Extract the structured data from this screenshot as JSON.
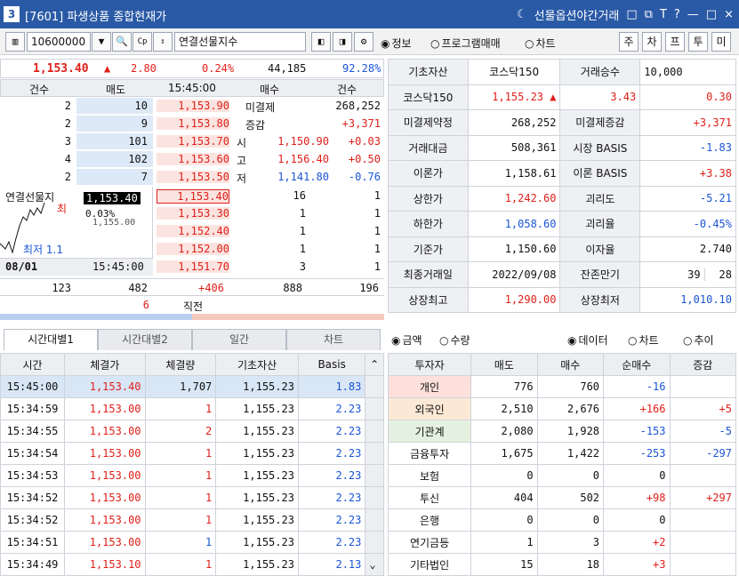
{
  "title": {
    "num": "3",
    "text": "[7601] 파생상품 종합현재가",
    "night": "선물옵션야간거래",
    "icons": [
      "□",
      "⧉",
      "T",
      "?",
      "—",
      "□",
      "×"
    ]
  },
  "toolbar": {
    "code": "10600000",
    "name": "연결선물지수",
    "radios": [
      "정보",
      "프로그램매매",
      "차트"
    ],
    "mini": [
      "주",
      "차",
      "프",
      "투",
      "미"
    ]
  },
  "quote": {
    "price": "1,153.40",
    "arrow": "▲",
    "change": "2.80",
    "rate": "0.24%",
    "volume": "44,185",
    "ratio": "92.28%"
  },
  "ob_head": [
    "건수",
    "매도",
    "15:45:00",
    "매수",
    "건수"
  ],
  "asks": [
    [
      "2",
      "10",
      "1,153.90"
    ],
    [
      "2",
      "9",
      "1,153.80"
    ],
    [
      "3",
      "101",
      "1,153.70"
    ],
    [
      "4",
      "102",
      "1,153.60"
    ],
    [
      "2",
      "7",
      "1,153.50"
    ]
  ],
  "ask_info": [
    [
      "미결제",
      "268,252",
      ""
    ],
    [
      "증감",
      "+3,371",
      ""
    ],
    [
      "시",
      "1,150.90",
      "+0.03"
    ],
    [
      "고",
      "1,156.40",
      "+0.50"
    ],
    [
      "저",
      "1,141.80",
      "-0.76"
    ]
  ],
  "bids": [
    [
      "1,153.40",
      "16",
      "1"
    ],
    [
      "1,153.30",
      "1",
      "1"
    ],
    [
      "1,152.40",
      "1",
      "1"
    ],
    [
      "1,152.00",
      "1",
      "1"
    ],
    [
      "1,151.70",
      "3",
      "1"
    ]
  ],
  "mini_chart": {
    "name": "연결선물지",
    "price": "1,153.40",
    "rate": "0.03%",
    "low_val": "1,155.00",
    "hi": "최",
    "lo": "최저 1.1",
    "date": "08/01",
    "time": "15:45:00"
  },
  "ob_total": [
    "123",
    "482",
    "+406",
    "888",
    "196"
  ],
  "ob_last": {
    "val": "6",
    "label": "직전"
  },
  "info": [
    [
      "기초자산",
      "코스닥150",
      "거래승수",
      "10,000"
    ],
    [
      "코스닥150",
      "1,155.23 ▲",
      "3.43",
      "0.30"
    ],
    [
      "미결제약정",
      "268,252",
      "미결제증감",
      "+3,371"
    ],
    [
      "거래대금",
      "508,361",
      "시장 BASIS",
      "-1.83"
    ],
    [
      "이론가",
      "1,158.61",
      "이론 BASIS",
      "+3.38"
    ],
    [
      "상한가",
      "1,242.60",
      "괴리도",
      "-5.21"
    ],
    [
      "하한가",
      "1,058.60",
      "괴리율",
      "-0.45%"
    ],
    [
      "기준가",
      "1,150.60",
      "이자율",
      "2.740"
    ],
    [
      "최종거래일",
      "2022/09/08",
      "잔존만기",
      "39",
      "28"
    ],
    [
      "상장최고",
      "1,290.00",
      "상장최저",
      "1,010.10"
    ]
  ],
  "tabs": [
    "시간대별1",
    "시간대별2",
    "일간",
    "차트"
  ],
  "trade_head": [
    "시간",
    "체결가",
    "체결량",
    "기초자산",
    "Basis"
  ],
  "trades": [
    [
      "15:45:00",
      "1,153.40",
      "1,707",
      "1,155.23",
      "1.83"
    ],
    [
      "15:34:59",
      "1,153.00",
      "1",
      "1,155.23",
      "2.23"
    ],
    [
      "15:34:55",
      "1,153.00",
      "2",
      "1,155.23",
      "2.23"
    ],
    [
      "15:34:54",
      "1,153.00",
      "1",
      "1,155.23",
      "2.23"
    ],
    [
      "15:34:53",
      "1,153.00",
      "1",
      "1,155.23",
      "2.23"
    ],
    [
      "15:34:52",
      "1,153.00",
      "1",
      "1,155.23",
      "2.23"
    ],
    [
      "15:34:52",
      "1,153.00",
      "1",
      "1,155.23",
      "2.23"
    ],
    [
      "15:34:51",
      "1,153.00",
      "1",
      "1,155.23",
      "2.23"
    ],
    [
      "15:34:49",
      "1,153.10",
      "1",
      "1,155.23",
      "2.13"
    ]
  ],
  "inv_radio": [
    "금액",
    "수량"
  ],
  "inv_radio2": [
    "데이터",
    "차트",
    "추이"
  ],
  "inv_head": [
    "투자자",
    "매도",
    "매수",
    "순매수",
    "증감"
  ],
  "investors": [
    [
      "개인",
      "776",
      "760",
      "-16",
      ""
    ],
    [
      "외국인",
      "2,510",
      "2,676",
      "+166",
      "+5"
    ],
    [
      "기관계",
      "2,080",
      "1,928",
      "-153",
      "-5"
    ],
    [
      "금융투자",
      "1,675",
      "1,422",
      "-253",
      "-297"
    ],
    [
      "보험",
      "0",
      "0",
      "0",
      ""
    ],
    [
      "투신",
      "404",
      "502",
      "+98",
      "+297"
    ],
    [
      "은행",
      "0",
      "0",
      "0",
      ""
    ],
    [
      "연기금등",
      "1",
      "3",
      "+2",
      ""
    ],
    [
      "기타법인",
      "15",
      "18",
      "+3",
      ""
    ]
  ],
  "colors": {
    "title_bg": "#2a5aa6",
    "up": "#e0201a",
    "down": "#1a55d6",
    "ask_bg": "#dde9f6",
    "bid_bg": "#fbe4e0"
  }
}
